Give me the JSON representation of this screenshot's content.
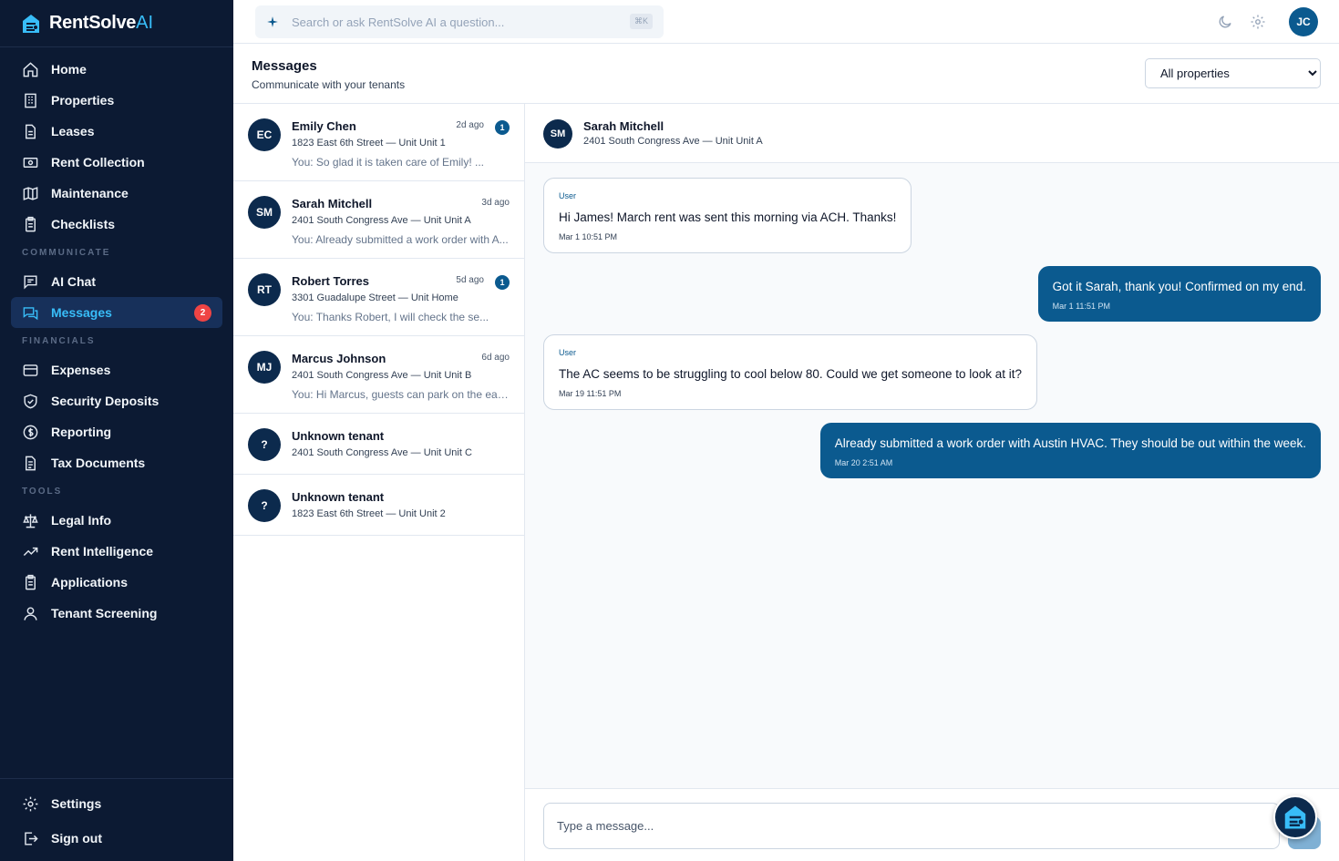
{
  "brand": {
    "name": "RentSolve",
    "suffix": "AI"
  },
  "nav": {
    "home": "Home",
    "properties": "Properties",
    "leases": "Leases",
    "rent_collection": "Rent Collection",
    "maintenance": "Maintenance",
    "checklists": "Checklists",
    "section_communicate": "COMMUNICATE",
    "ai_chat": "AI Chat",
    "messages": "Messages",
    "messages_badge": "2",
    "section_financials": "FINANCIALS",
    "expenses": "Expenses",
    "security_deposits": "Security Deposits",
    "reporting": "Reporting",
    "tax_documents": "Tax Documents",
    "section_tools": "TOOLS",
    "legal_info": "Legal Info",
    "rent_intelligence": "Rent Intelligence",
    "applications": "Applications",
    "tenant_screening": "Tenant Screening",
    "settings": "Settings",
    "sign_out": "Sign out"
  },
  "topbar": {
    "search_placeholder": "Search or ask RentSolve AI a question...",
    "shortcut": "⌘K",
    "user_initials": "JC"
  },
  "page": {
    "title": "Messages",
    "subtitle": "Communicate with your tenants",
    "property_filter": "All properties"
  },
  "conversations": [
    {
      "initials": "EC",
      "name": "Emily Chen",
      "time": "2d ago",
      "unread": "1",
      "address": "1823 East 6th Street — Unit Unit 1",
      "preview": "You: So glad it is taken care of Emily! ..."
    },
    {
      "initials": "SM",
      "name": "Sarah Mitchell",
      "time": "3d ago",
      "unread": "",
      "address": "2401 South Congress Ave — Unit Unit A",
      "preview": "You: Already submitted a work order with A..."
    },
    {
      "initials": "RT",
      "name": "Robert Torres",
      "time": "5d ago",
      "unread": "1",
      "address": "3301 Guadalupe Street — Unit Home",
      "preview": "You: Thanks Robert, I will check the se..."
    },
    {
      "initials": "MJ",
      "name": "Marcus Johnson",
      "time": "6d ago",
      "unread": "",
      "address": "2401 South Congress Ave — Unit Unit B",
      "preview": "You: Hi Marcus, guests can park on the east..."
    },
    {
      "initials": "?",
      "name": "Unknown tenant",
      "address": "2401 South Congress Ave — Unit Unit C"
    },
    {
      "initials": "?",
      "name": "Unknown tenant",
      "address": "1823 East 6th Street — Unit Unit 2"
    }
  ],
  "chat": {
    "initials": "SM",
    "name": "Sarah Mitchell",
    "address": "2401 South Congress Ave — Unit Unit A",
    "messages": [
      {
        "direction": "in",
        "role": "User",
        "text": "Hi James! March rent was sent this morning via ACH. Thanks!",
        "time": "Mar 1 10:51 PM"
      },
      {
        "direction": "out",
        "text": "Got it Sarah, thank you! Confirmed on my end.",
        "time": "Mar 1 11:51 PM"
      },
      {
        "direction": "in",
        "role": "User",
        "text": "The AC seems to be struggling to cool below 80. Could we get someone to look at it?",
        "time": "Mar 19 11:51 PM"
      },
      {
        "direction": "out",
        "text": "Already submitted a work order with Austin HVAC. They should be out within the week.",
        "time": "Mar 20 2:51 AM"
      }
    ],
    "composer_placeholder": "Type a message..."
  },
  "colors": {
    "sidebar": "#0c1a33",
    "accent": "#0b5a8f",
    "active_text": "#38bdf8",
    "badge": "#ef4444"
  }
}
